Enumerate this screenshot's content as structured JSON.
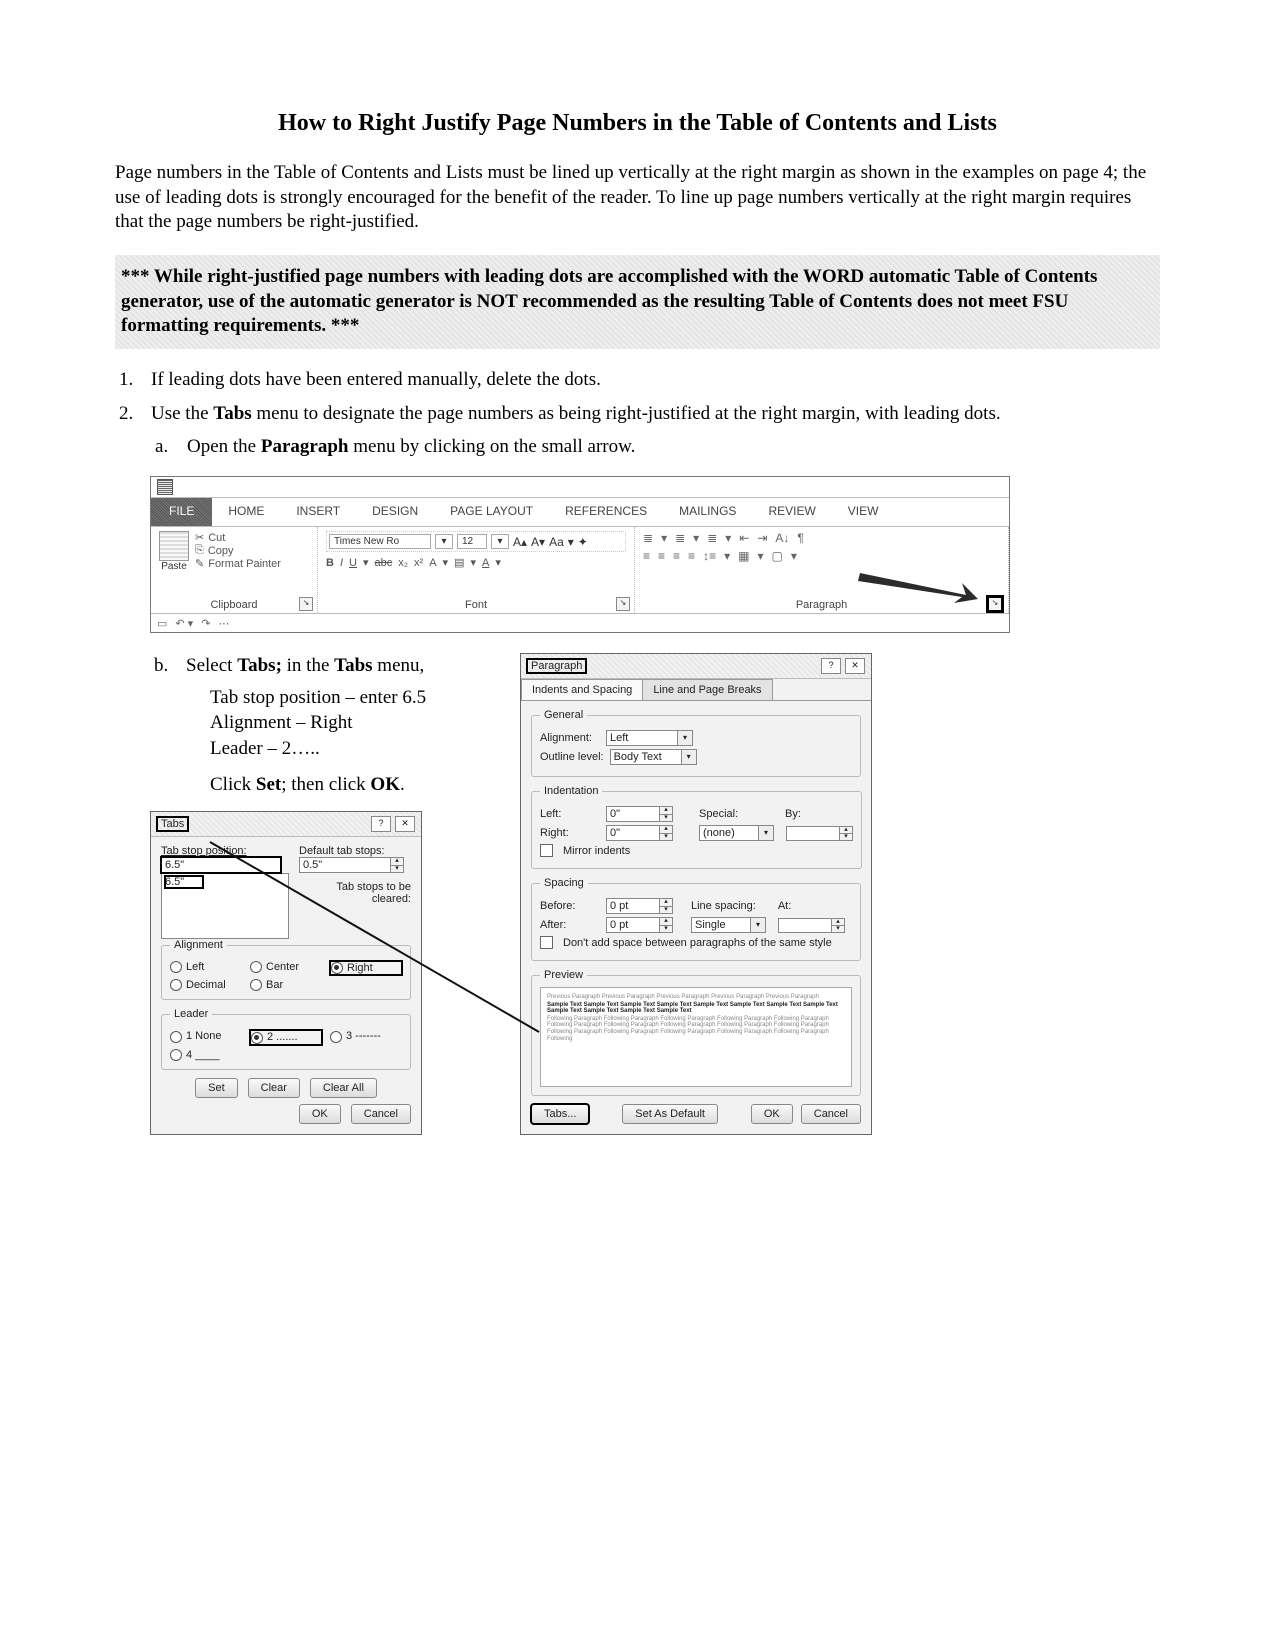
{
  "title": "How to Right Justify Page Numbers in the Table of Contents and Lists",
  "intro": "Page numbers in the Table of Contents and Lists must be lined up vertically at the right margin as shown in the examples on page 4; the use of leading dots is strongly encouraged for the benefit of the reader. To line up page numbers vertically at the right margin requires that the page numbers be right-justified.",
  "highlight": "*** While right-justified page numbers with leading dots are accomplished with the WORD automatic Table of Contents generator, use of the automatic generator is NOT recommended as the resulting Table of Contents does not meet FSU formatting requirements. ***",
  "steps": {
    "one": "If leading dots have been entered manually, delete the dots.",
    "two_lead": "Use the ",
    "two_bold": "Tabs",
    "two_rest": " menu to designate the page numbers as being right-justified at the right margin, with leading dots.",
    "a_lead": "Open the ",
    "a_bold": "Paragraph",
    "a_rest": " menu by clicking on the small arrow.",
    "b_lead": "Select ",
    "b_bold1": "Tabs;",
    "b_mid": " in the ",
    "b_bold2": "Tabs",
    "b_rest": " menu,",
    "b_line1": "Tab stop position – enter 6.5",
    "b_line2": "Alignment – Right",
    "b_line3": "Leader – 2…..",
    "b_click_lead": "Click ",
    "b_click_set": "Set",
    "b_click_mid": "; then click ",
    "b_click_ok": "OK",
    "b_click_end": "."
  },
  "ribbon": {
    "tabs": {
      "file": "FILE",
      "home": "HOME",
      "insert": "INSERT",
      "design": "DESIGN",
      "pagelayout": "PAGE LAYOUT",
      "references": "REFERENCES",
      "mailings": "MAILINGS",
      "review": "REVIEW",
      "view": "VIEW"
    },
    "paste": "Paste",
    "cut": "Cut",
    "copy": "Copy",
    "formatpainter": "Format Painter",
    "clipboard": "Clipboard",
    "font": "Font",
    "paragraph": "Paragraph",
    "fontname": "Times New Ro",
    "fontsize": "12",
    "bold": "B",
    "italic": "I",
    "underline": "U",
    "abc": "abc",
    "x2": "x₂",
    "x2sup": "x²",
    "Aa": "Aa"
  },
  "paragraph_dialog": {
    "title": "Paragraph",
    "tab1": "Indents and Spacing",
    "tab2": "Line and Page Breaks",
    "general": "General",
    "alignment_label": "Alignment:",
    "alignment_value": "Left",
    "outline_label": "Outline level:",
    "outline_value": "Body Text",
    "indentation": "Indentation",
    "left_label": "Left:",
    "left_value": "0\"",
    "right_label": "Right:",
    "right_value": "0\"",
    "special_label": "Special:",
    "special_value": "(none)",
    "by_label": "By:",
    "mirror": "Mirror indents",
    "spacing": "Spacing",
    "before_label": "Before:",
    "before_value": "0 pt",
    "after_label": "After:",
    "after_value": "0 pt",
    "linespacing_label": "Line spacing:",
    "linespacing_value": "Single",
    "at_label": "At:",
    "dontadd": "Don't add space between paragraphs of the same style",
    "preview": "Preview",
    "btn_tabs": "Tabs...",
    "btn_default": "Set As Default",
    "btn_ok": "OK",
    "btn_cancel": "Cancel"
  },
  "tabs_dialog": {
    "title": "Tabs",
    "tabstop_label": "Tab stop position:",
    "tabstop_value": "6.5\"",
    "list_item": "6.5\"",
    "default_label": "Default tab stops:",
    "default_value": "0.5\"",
    "cleared_label": "Tab stops to be cleared:",
    "alignment": "Alignment",
    "a_left": "Left",
    "a_center": "Center",
    "a_right": "Right",
    "a_decimal": "Decimal",
    "a_bar": "Bar",
    "leader": "Leader",
    "l1": "1 None",
    "l2": "2 .......",
    "l3": "3 -------",
    "l4": "4 ____",
    "btn_set": "Set",
    "btn_clear": "Clear",
    "btn_clearall": "Clear All",
    "btn_ok": "OK",
    "btn_cancel": "Cancel"
  }
}
